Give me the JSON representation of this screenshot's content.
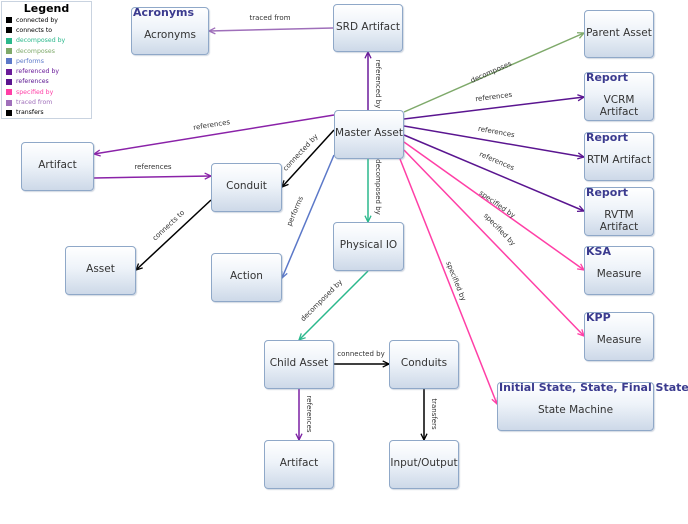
{
  "legend": {
    "title": "Legend",
    "items": [
      {
        "label": "connected by",
        "color": "#000000"
      },
      {
        "label": "connects to",
        "color": "#000000"
      },
      {
        "label": "decomposed by",
        "color": "#2bb88c"
      },
      {
        "label": "decomposes",
        "color": "#7ea96a"
      },
      {
        "label": "performs",
        "color": "#5b78c8"
      },
      {
        "label": "referenced by",
        "color": "#6a1b9a"
      },
      {
        "label": "references",
        "color": "#5a1590"
      },
      {
        "label": "specified by",
        "color": "#ff3fa6"
      },
      {
        "label": "traced from",
        "color": "#9f6fba"
      },
      {
        "label": "transfers",
        "color": "#000000"
      }
    ]
  },
  "nodes": {
    "acronyms": {
      "stereotype": "Acronyms",
      "label": "Acronyms"
    },
    "srd_artifact": {
      "label": "SRD Artifact"
    },
    "parent_asset": {
      "label": "Parent Asset"
    },
    "vcrm_artifact": {
      "stereotype": "Report",
      "label": "VCRM Artifact"
    },
    "master_asset": {
      "label": "Master Asset"
    },
    "rtm_artifact": {
      "stereotype": "Report",
      "label": "RTM Artifact"
    },
    "rvtm_artifact": {
      "stereotype": "Report",
      "label": "RVTM Artifact"
    },
    "artifact_left": {
      "label": "Artifact"
    },
    "conduit": {
      "label": "Conduit"
    },
    "asset": {
      "label": "Asset"
    },
    "action": {
      "label": "Action"
    },
    "physical_io": {
      "label": "Physical IO"
    },
    "ksa_measure": {
      "stereotype": "KSA",
      "label": "Measure"
    },
    "kpp_measure": {
      "stereotype": "KPP",
      "label": "Measure"
    },
    "child_asset": {
      "label": "Child Asset"
    },
    "conduits": {
      "label": "Conduits"
    },
    "state_machine": {
      "stereotype": "Initial State, State, Final State",
      "label": "State Machine"
    },
    "artifact_bottom": {
      "label": "Artifact"
    },
    "input_output": {
      "label": "Input/Output"
    }
  },
  "edges": [
    {
      "from": "srd_artifact",
      "to": "acronyms",
      "label": "traced from",
      "color": "#9f6fba"
    },
    {
      "from": "master_asset",
      "to": "srd_artifact",
      "label": "referenced by",
      "color": "#6a1b9a"
    },
    {
      "from": "master_asset",
      "to": "parent_asset",
      "label": "decomposes",
      "color": "#7ea96a"
    },
    {
      "from": "master_asset",
      "to": "vcrm_artifact",
      "label": "references",
      "color": "#5a1590"
    },
    {
      "from": "master_asset",
      "to": "rtm_artifact",
      "label": "references",
      "color": "#5a1590"
    },
    {
      "from": "master_asset",
      "to": "rvtm_artifact",
      "label": "references",
      "color": "#5a1590"
    },
    {
      "from": "master_asset",
      "to": "ksa_measure",
      "label": "specified by",
      "color": "#ff3fa6"
    },
    {
      "from": "master_asset",
      "to": "kpp_measure",
      "label": "specified by",
      "color": "#ff3fa6"
    },
    {
      "from": "master_asset",
      "to": "state_machine",
      "label": "specified by",
      "color": "#ff3fa6"
    },
    {
      "from": "master_asset",
      "to": "artifact_left",
      "label": "references",
      "color": "#8a22a8"
    },
    {
      "from": "artifact_left",
      "to": "conduit",
      "label": "references",
      "color": "#8a22a8"
    },
    {
      "from": "master_asset",
      "to": "conduit",
      "label": "connected by",
      "color": "#000000"
    },
    {
      "from": "conduit",
      "to": "asset",
      "label": "connects to",
      "color": "#000000"
    },
    {
      "from": "master_asset",
      "to": "action",
      "label": "performs",
      "color": "#5b78c8"
    },
    {
      "from": "master_asset",
      "to": "physical_io",
      "label": "decomposed by",
      "color": "#2bb88c"
    },
    {
      "from": "physical_io",
      "to": "child_asset",
      "label": "decomposed by",
      "color": "#2bb88c"
    },
    {
      "from": "child_asset",
      "to": "conduits",
      "label": "connected by",
      "color": "#000000"
    },
    {
      "from": "child_asset",
      "to": "artifact_bottom",
      "label": "references",
      "color": "#7b1fa2"
    },
    {
      "from": "conduits",
      "to": "input_output",
      "label": "transfers",
      "color": "#000000"
    }
  ]
}
